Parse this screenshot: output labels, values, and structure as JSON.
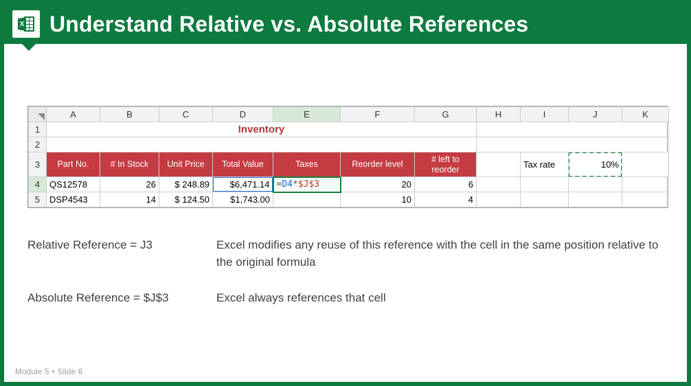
{
  "header": {
    "title": "Understand Relative vs. Absolute References"
  },
  "sheet": {
    "columns": [
      "A",
      "B",
      "C",
      "D",
      "E",
      "F",
      "G",
      "H",
      "I",
      "J",
      "K"
    ],
    "row_numbers": [
      "1",
      "2",
      "3",
      "4",
      "5"
    ],
    "inventory_title": "Inventory",
    "headers": {
      "part_no": "Part No.",
      "in_stock": "# In Stock",
      "unit_price": "Unit Price",
      "total_value": "Total Value",
      "taxes": "Taxes",
      "reorder_level": "Reorder level",
      "left_to_reorder": "# left to reorder",
      "tax_rate": "Tax rate"
    },
    "rows": [
      {
        "part": "QS12578",
        "stock": "26",
        "price": "$ 248.89",
        "total": "$6,471.14",
        "reorder": "20",
        "left": "6"
      },
      {
        "part": "DSP4543",
        "stock": "14",
        "price": "$ 124.50",
        "total": "$1,743.00",
        "reorder": "10",
        "left": "4"
      }
    ],
    "formula": {
      "prefix": "=",
      "rel": "D4",
      "op": "*",
      "abs": "$J$3"
    },
    "tax_rate_value": "10%"
  },
  "explain": {
    "rel_label": "Relative Reference = J3",
    "rel_desc": "Excel modifies any reuse of this reference with the cell in the same position relative to the original formula",
    "abs_label": "Absolute Reference = $J$3",
    "abs_desc": "Excel always references that cell"
  },
  "footer": {
    "module": "Module 5",
    "slide": "Slide 6"
  }
}
